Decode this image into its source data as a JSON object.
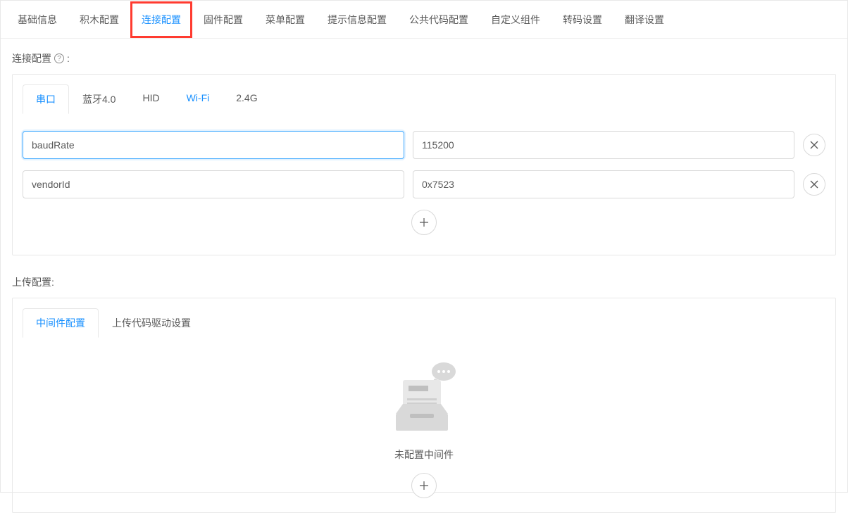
{
  "mainTabs": {
    "items": [
      {
        "label": "基础信息"
      },
      {
        "label": "积木配置"
      },
      {
        "label": "连接配置"
      },
      {
        "label": "固件配置"
      },
      {
        "label": "菜单配置"
      },
      {
        "label": "提示信息配置"
      },
      {
        "label": "公共代码配置"
      },
      {
        "label": "自定义组件"
      },
      {
        "label": "转码设置"
      },
      {
        "label": "翻译设置"
      }
    ]
  },
  "connection": {
    "title": "连接配置",
    "tabs": [
      {
        "label": "串口"
      },
      {
        "label": "蓝牙4.0"
      },
      {
        "label": "HID"
      },
      {
        "label": "Wi-Fi"
      },
      {
        "label": "2.4G"
      }
    ],
    "rows": [
      {
        "key": "baudRate",
        "value": "115200"
      },
      {
        "key": "vendorId",
        "value": "0x7523"
      }
    ]
  },
  "upload": {
    "title": "上传配置:",
    "tabs": [
      {
        "label": "中间件配置"
      },
      {
        "label": "上传代码驱动设置"
      }
    ],
    "emptyText": "未配置中间件"
  }
}
